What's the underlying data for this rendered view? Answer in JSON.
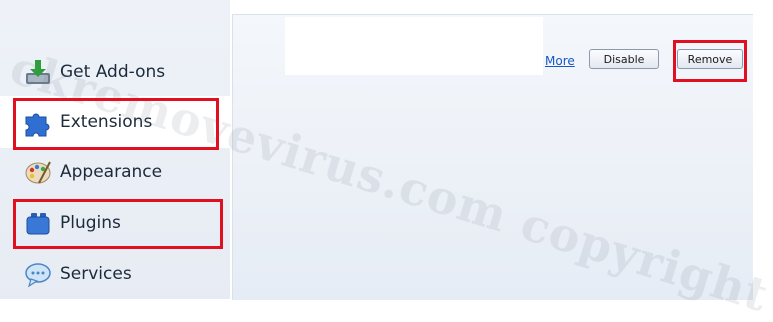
{
  "sidebar": {
    "items": [
      {
        "label": "Get Add-ons",
        "icon": "download-icon"
      },
      {
        "label": "Extensions",
        "icon": "puzzle-icon"
      },
      {
        "label": "Appearance",
        "icon": "palette-icon"
      },
      {
        "label": "Plugins",
        "icon": "lego-block-icon"
      },
      {
        "label": "Services",
        "icon": "speech-bubble-icon"
      }
    ],
    "selected": "Extensions"
  },
  "main": {
    "more_link": "More",
    "disable_label": "Disable",
    "remove_label": "Remove"
  },
  "watermark": "ckremovevirus.com copyright",
  "colors": {
    "highlight": "#e01020",
    "link": "#1a56c8",
    "sidebar_bg": "#eef2f8"
  }
}
